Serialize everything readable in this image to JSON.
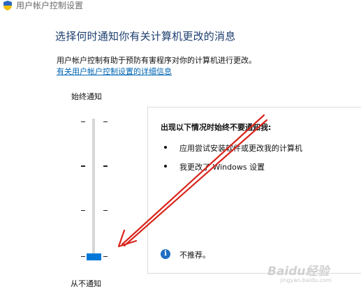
{
  "window": {
    "title": "用户帐户控制设置",
    "icon": "shield-icon"
  },
  "main": {
    "heading": "选择何时通知你有关计算机更改的消息",
    "description": "用户帐户控制有助于预防有害程序对你的计算机进行更改。",
    "link": "有关用户帐户控制设置的详细信息"
  },
  "slider": {
    "top_label": "始终通知",
    "bottom_label": "从不通知",
    "level": 1,
    "levels": 4
  },
  "panel": {
    "title": "出现以下情况时始终不要通知我:",
    "bullets": [
      "应用尝试安装软件或更改我的计算机",
      "我更改了 Windows 设置"
    ],
    "info_icon": "info-icon",
    "info_text": "不推荐。"
  },
  "watermark": {
    "line1": "Baidu经验",
    "line2": "jingyan.baidu.com"
  },
  "colors": {
    "accent": "#0078d7",
    "heading": "#1c3e6e",
    "link": "#0066b4",
    "arrow": "#d9251c"
  }
}
